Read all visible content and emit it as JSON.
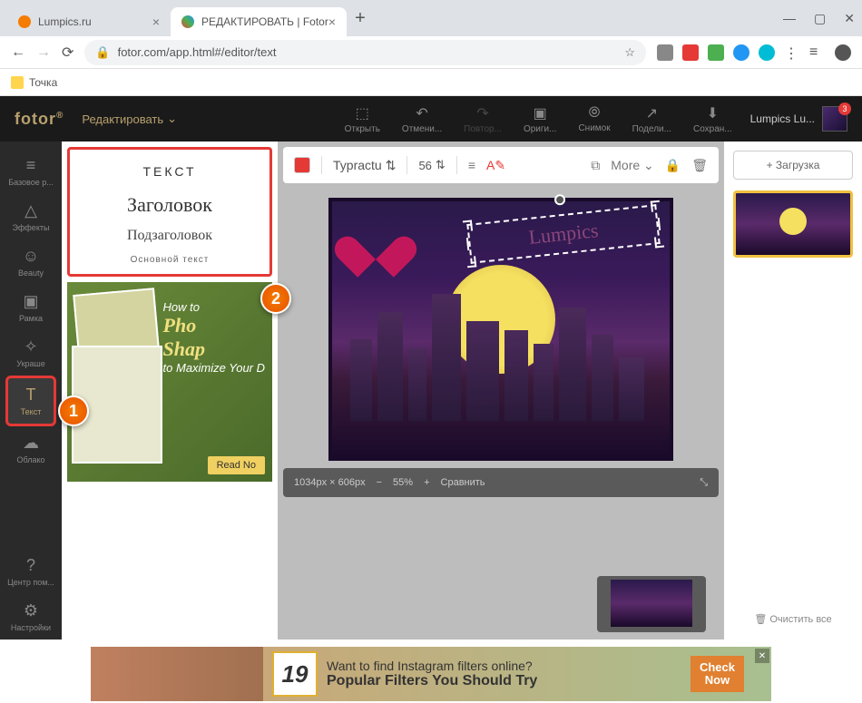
{
  "browser": {
    "tabs": [
      {
        "title": "Lumpics.ru",
        "favicon_color": "#f57c00"
      },
      {
        "title": "РЕДАКТИРОВАТЬ | Fotor",
        "favicon_color": "#4caf50"
      }
    ],
    "url": "fotor.com/app.html#/editor/text",
    "bookmark": "Точка"
  },
  "app": {
    "logo": "fotor",
    "mode": "Редактировать",
    "top_actions": {
      "open": "Открыть",
      "undo": "Отмени...",
      "redo": "Повтор...",
      "original": "Ориги...",
      "snapshot": "Снимок",
      "share": "Подели...",
      "save": "Сохран..."
    },
    "user": "Lumpics Lu...",
    "notif_count": "3"
  },
  "sidebar": {
    "basic": "Базовое р...",
    "effects": "Эффекты",
    "beauty": "Beauty",
    "frame": "Рамка",
    "stickers": "Украше",
    "text": "Текст",
    "cloud": "Облако",
    "help": "Центр пом...",
    "settings": "Настройки"
  },
  "text_panel": {
    "title": "ТЕКСТ",
    "heading": "Заголовок",
    "subheading": "Подзаголовок",
    "body": "Основной текст",
    "promo": {
      "line1": "How to",
      "line2a": "Pho",
      "line2b": "Shap",
      "line3": "to Maximize Your D",
      "read": "Read No"
    }
  },
  "text_toolbar": {
    "font": "Typractu",
    "size": "56",
    "more": "More"
  },
  "canvas": {
    "text_content": "Lumpics"
  },
  "zoom": {
    "dimensions": "1034px × 606px",
    "level": "55%",
    "compare": "Сравнить"
  },
  "right_panel": {
    "upload": "Загрузка",
    "clear": "Очистить все"
  },
  "ad": {
    "number": "19",
    "line1": "Want to find Instagram filters online?",
    "line2": "Popular Filters You Should Try",
    "btn1": "Check",
    "btn2": "Now"
  },
  "annotations": {
    "one": "1",
    "two": "2"
  }
}
